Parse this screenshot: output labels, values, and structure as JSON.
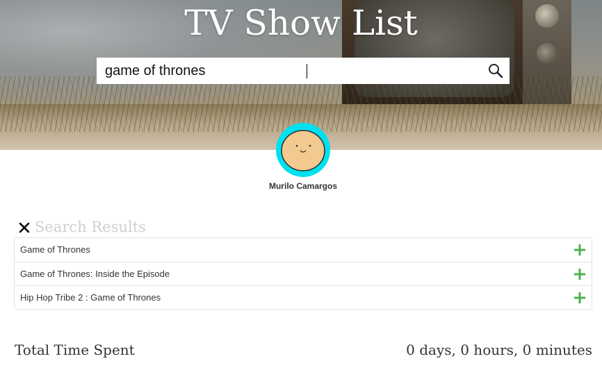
{
  "header": {
    "title": "TV Show List",
    "search": {
      "value": "game of thrones",
      "placeholder": "",
      "icon": "search-icon"
    }
  },
  "profile": {
    "name": "Murilo Camargos",
    "avatar_color": "#00e1f0"
  },
  "results": {
    "title": "Search Results",
    "close_icon": "close-icon",
    "items": [
      {
        "label": "Game of Thrones",
        "action_icon": "plus-icon"
      },
      {
        "label": "Game of Thrones: Inside the Episode",
        "action_icon": "plus-icon"
      },
      {
        "label": "Hip Hop Tribe 2 : Game of Thrones",
        "action_icon": "plus-icon"
      }
    ],
    "add_color": "#4caf50"
  },
  "totals": {
    "label": "Total Time Spent",
    "value": "0 days, 0 hours, 0 minutes"
  }
}
